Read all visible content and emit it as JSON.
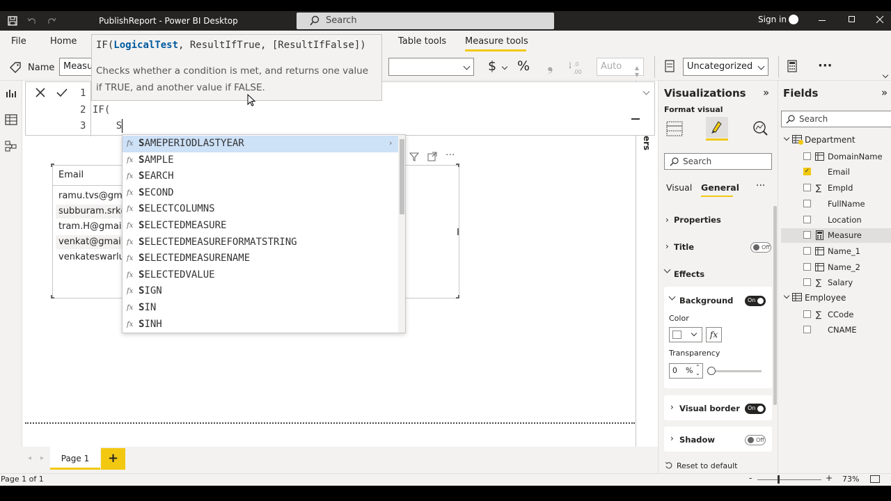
{
  "titlebar": {
    "title": "PublishReport - Power BI Desktop",
    "search_placeholder": "Search",
    "signin": "Sign in"
  },
  "ribbon": {
    "tabs": [
      "File",
      "Home",
      "Table tools",
      "Measure tools"
    ],
    "name_label": "Name",
    "name_value": "Measure",
    "format_auto": "Auto",
    "currency_symbol": "$",
    "percent_symbol": "%",
    "decimal_symbol": ",00\n→.0",
    "category_value": "Uncategorized"
  },
  "tooltip": {
    "func": "IF(",
    "param1": "LogicalTest",
    "rest": ", ResultIfTrue, [ResultIfFalse])",
    "description_line1": "Checks whether a condition is met, and returns one value",
    "description_line2": "if TRUE, and another value if FALSE."
  },
  "formula": {
    "lines": [
      {
        "num": "1",
        "text": ""
      },
      {
        "num": "2",
        "text": "IF("
      },
      {
        "num": "3",
        "text": "    S"
      }
    ]
  },
  "autocomplete": {
    "items": [
      {
        "first": "S",
        "rest": "AMEPERIODLASTYEAR"
      },
      {
        "first": "S",
        "rest": "AMPLE"
      },
      {
        "first": "S",
        "rest": "EARCH"
      },
      {
        "first": "S",
        "rest": "ECOND"
      },
      {
        "first": "S",
        "rest": "ELECTCOLUMNS"
      },
      {
        "first": "S",
        "rest": "ELECTEDMEASURE"
      },
      {
        "first": "S",
        "rest": "ELECTEDMEASUREFORMATSTRING"
      },
      {
        "first": "S",
        "rest": "ELECTEDMEASURENAME"
      },
      {
        "first": "S",
        "rest": "ELECTEDVALUE"
      },
      {
        "first": "S",
        "rest": "IGN"
      },
      {
        "first": "S",
        "rest": "IN"
      },
      {
        "first": "S",
        "rest": "INH"
      }
    ],
    "fx": "fx"
  },
  "table_visual": {
    "header": "Email",
    "rows": [
      "ramu.tvs@gma",
      "subburam.srk@",
      "tram.H@gmail.c",
      "venkat@gmail.c",
      "venkateswarlu@"
    ]
  },
  "side_label": "ers",
  "pages": {
    "tab": "Page 1",
    "add": "+"
  },
  "status": {
    "page": "Page 1 of 1",
    "zoom": "73%",
    "minus": "-",
    "plus": "+"
  },
  "viz": {
    "title": "Visualizations",
    "format_visual": "Format visual",
    "search_placeholder": "Search",
    "tab_visual": "Visual",
    "tab_general": "General",
    "more": "···",
    "properties": "Properties",
    "title_section": "Title",
    "title_toggle": "Off",
    "effects": "Effects",
    "background": "Background",
    "background_toggle": "On",
    "color_label": "Color",
    "fx_label": "fx",
    "transparency_label": "Transparency",
    "transparency_value": "0",
    "percent": "%",
    "visual_border": "Visual border",
    "visual_border_toggle": "On",
    "shadow": "Shadow",
    "shadow_toggle": "Off",
    "reset": "Reset to default"
  },
  "fields": {
    "title": "Fields",
    "search_placeholder": "Search",
    "tables": [
      {
        "name": "Department",
        "items": [
          {
            "name": "DomainName",
            "icon": "calc-column-icon",
            "checked": false
          },
          {
            "name": "Email",
            "icon": "",
            "checked": true
          },
          {
            "name": "EmpId",
            "icon": "sigma-icon",
            "checked": false
          },
          {
            "name": "FullName",
            "icon": "",
            "checked": false
          },
          {
            "name": "Location",
            "icon": "",
            "checked": false
          },
          {
            "name": "Measure",
            "icon": "calculator-icon",
            "checked": false
          },
          {
            "name": "Name_1",
            "icon": "calc-column-icon",
            "checked": false
          },
          {
            "name": "Name_2",
            "icon": "calc-column-icon",
            "checked": false
          },
          {
            "name": "Salary",
            "icon": "sigma-icon",
            "checked": false
          }
        ]
      },
      {
        "name": "Employee",
        "items": [
          {
            "name": "CCode",
            "icon": "sigma-icon",
            "checked": false
          },
          {
            "name": "CNAME",
            "icon": "",
            "checked": false
          }
        ]
      }
    ]
  },
  "colors": {
    "accent": "#f2c811",
    "selection": "#cde1f7",
    "titlebar": "#252423"
  }
}
